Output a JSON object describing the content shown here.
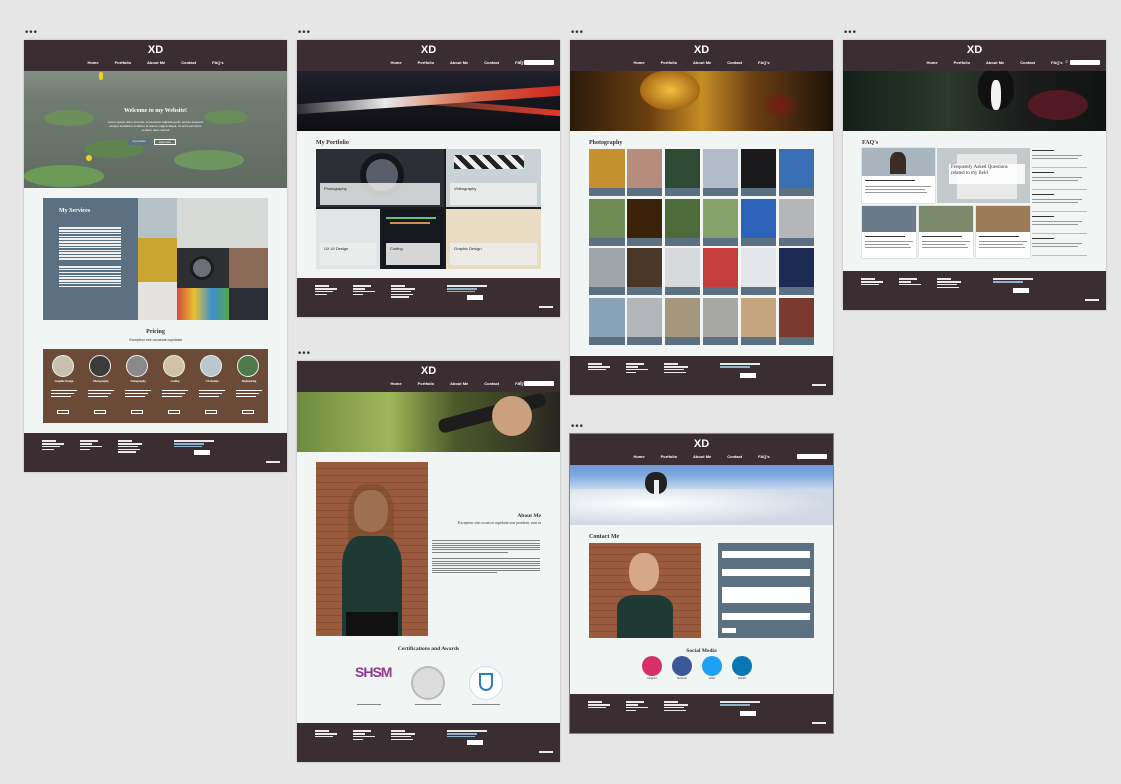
{
  "site": {
    "logo": "XD",
    "nav": [
      "Home",
      "Portfolio",
      "About Me",
      "Contact",
      "FAQ's"
    ]
  },
  "artboard_dots": "•••",
  "home": {
    "hero_title": "Welcome to my Website!",
    "hero_text": "Lorem ipsum dolor sit amet, consectetur adipiscing elit, sed do eiusmod tempor incididunt ut labore et dolore magna aliqua. Ut enim ad minim veniam, quis nostrud",
    "hero_buttons": [
      "my services",
      "learn more"
    ],
    "services_title": "My Services",
    "pricing_title": "Pricing",
    "pricing_subtitle": "Excepteur sint occaecat cupidatat",
    "pricing_cards": [
      {
        "name": "Graphic Design",
        "color": "#c8bfae"
      },
      {
        "name": "Photography",
        "color": "#3b3b3b"
      },
      {
        "name": "Videography",
        "color": "#8a8a8a"
      },
      {
        "name": "Coding",
        "color": "#cfc2a9"
      },
      {
        "name": "UX Design",
        "color": "#b9c7cf"
      },
      {
        "name": "Engineering",
        "color": "#4c7a4a"
      }
    ]
  },
  "portfolio": {
    "title": "My Portfolio",
    "tiles": [
      "Photography",
      "Videography",
      "UX UI Design",
      "Coding",
      "Graphic Design"
    ]
  },
  "photography": {
    "title": "Photography"
  },
  "faq": {
    "title": "FAQ's",
    "feature_caption": "Frequently Asked Questions related to my field"
  },
  "about": {
    "title": "About Me",
    "subtitle": "Excepteur sint occaecat cupidatat non proident, sunt in",
    "certs_title": "Certifications and Awards",
    "cert_logo": "SHSM"
  },
  "contact": {
    "title": "Contact Me",
    "social_title": "Social Media",
    "socials": [
      {
        "name": "instagram",
        "color": "#d6306b"
      },
      {
        "name": "facebook",
        "color": "#3b5998"
      },
      {
        "name": "twitter",
        "color": "#1da1f2"
      },
      {
        "name": "linkedin",
        "color": "#0a77b5"
      }
    ]
  },
  "colors": {
    "nav": "#3a2e33",
    "accent_panel": "#5b7080",
    "page_bg": "#f1f5f4",
    "canvas": "#e6e6e6",
    "selection": "#4a90e2"
  }
}
